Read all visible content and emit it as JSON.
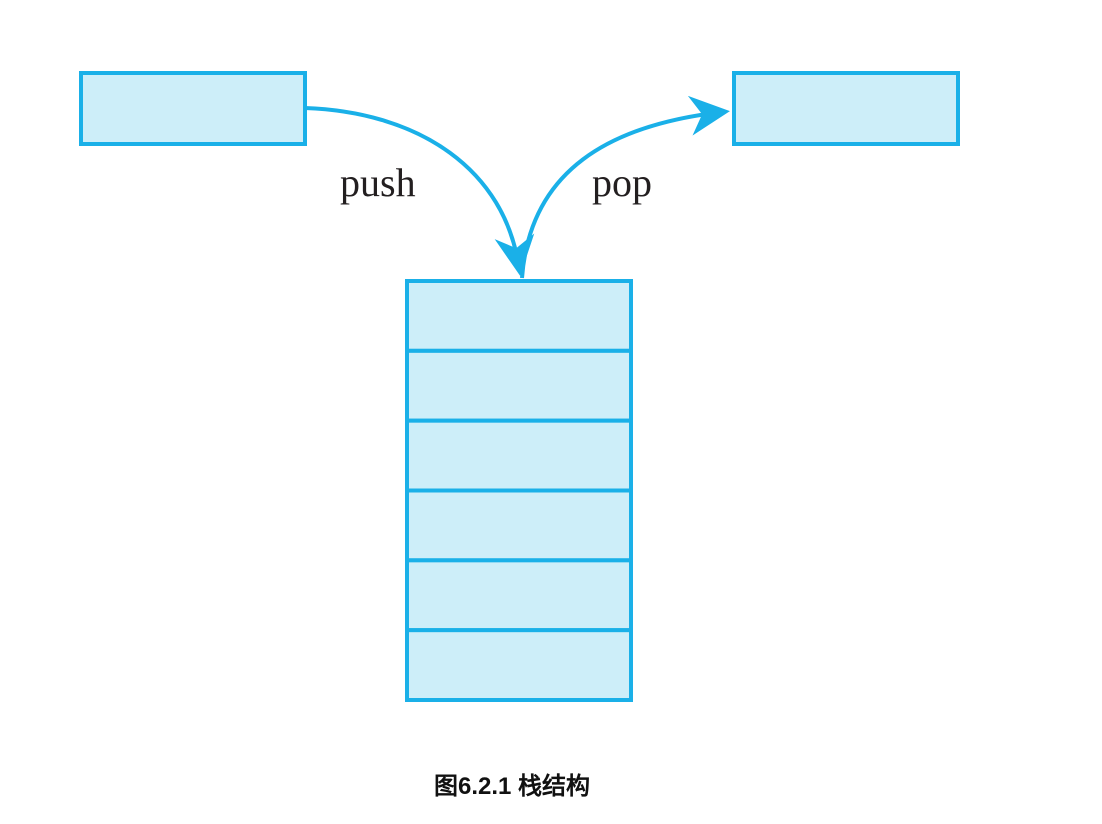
{
  "diagram": {
    "push_label": "push",
    "pop_label": "pop",
    "stack_cell_count": 6,
    "caption": "图6.2.1 栈结构",
    "colors": {
      "stroke": "#1ab0e8",
      "fill": "#cdeef9",
      "text": "#231f20"
    }
  }
}
